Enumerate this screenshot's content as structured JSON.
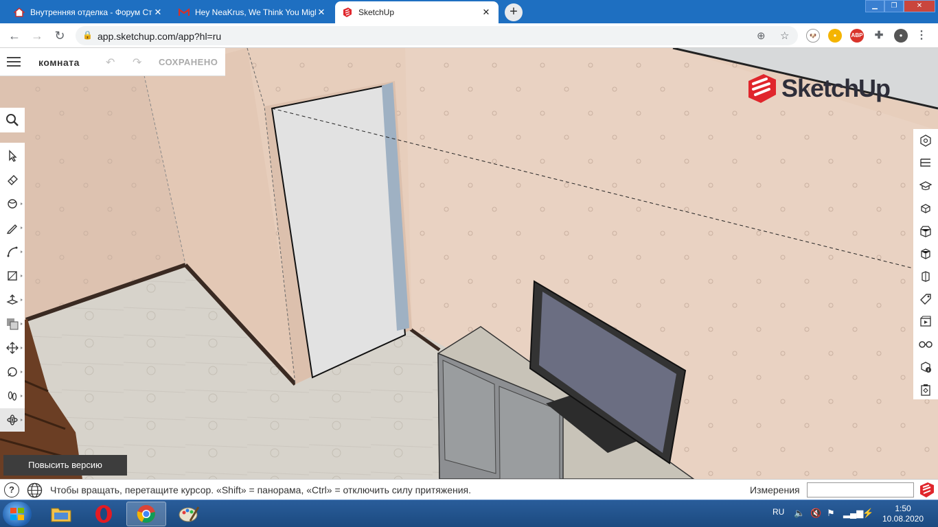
{
  "browser": {
    "tabs": [
      {
        "title": "Внутренняя отделка - Форум Ст",
        "favicon": "house-icon"
      },
      {
        "title": "Hey NeaKrus, We Think You Migh",
        "favicon": "gmail-icon"
      },
      {
        "title": "SketchUp",
        "favicon": "sketchup-icon"
      }
    ],
    "new_tab": "+",
    "url": "app.sketchup.com/app?hl=ru",
    "extensions": [
      {
        "name": "dog-extension-icon",
        "label": ""
      },
      {
        "name": "coin-extension-icon",
        "label": ""
      },
      {
        "name": "adblock-extension-icon",
        "label": "ABP"
      },
      {
        "name": "puzzle-extension-icon",
        "label": ""
      }
    ],
    "window_controls": [
      "minimize-icon",
      "maximize-icon",
      "close-icon"
    ]
  },
  "app": {
    "model_name": "комната",
    "save_status": "СОХРАНЕНО",
    "brand": "SketchUp",
    "upgrade_label": "Повысить версию",
    "left_tools": [
      "select-tool-icon",
      "eraser-tool-icon",
      "paint-bucket-tool-icon",
      "pencil-tool-icon",
      "arc-tool-icon",
      "rectangle-tool-icon",
      "push-pull-tool-icon",
      "offset-tool-icon",
      "move-tool-icon",
      "tape-measure-tool-icon",
      "walk-tool-icon",
      "orbit-tool-icon"
    ],
    "selected_tool": "orbit-tool-icon",
    "right_panels": [
      "entity-info-icon",
      "outliner-icon",
      "instructor-icon",
      "components-icon",
      "materials-icon",
      "styles-icon",
      "scenes-icon",
      "tags-icon",
      "views-icon",
      "display-icon",
      "model-info-icon",
      "solid-inspector-icon"
    ]
  },
  "status": {
    "hint": "Чтобы вращать, перетащите курсор. «Shift» = панорама, «Ctrl» = отключить силу притяжения.",
    "measurements_label": "Измерения",
    "measurements_value": ""
  },
  "taskbar": {
    "apps": [
      "explorer-icon",
      "opera-icon",
      "chrome-icon",
      "paint-icon"
    ],
    "active_app": "chrome-icon",
    "language": "RU",
    "time": "1:50",
    "date": "10.08.2020"
  }
}
